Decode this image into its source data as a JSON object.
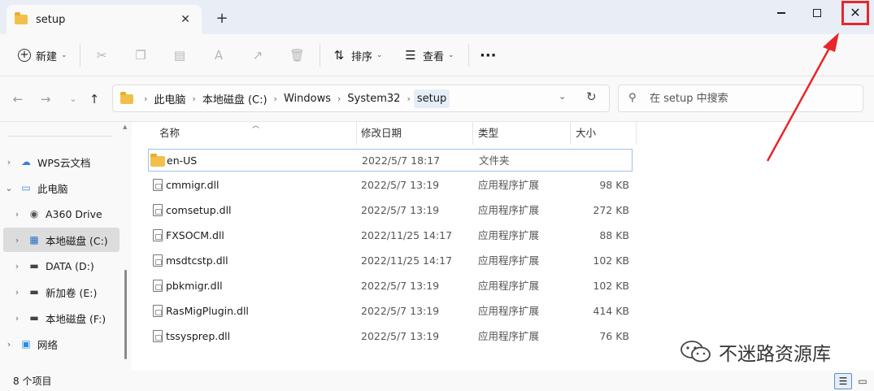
{
  "tab": {
    "title": "setup",
    "close_glyph": "✕",
    "new_tab_glyph": "+"
  },
  "window": {
    "minimize_glyph": "",
    "close_glyph": "✕"
  },
  "toolbar": {
    "new_label": "新建",
    "sort_label": "排序",
    "view_label": "查看",
    "more_glyph": "···"
  },
  "address": {
    "crumbs": [
      "此电脑",
      "本地磁盘 (C:)",
      "Windows",
      "System32",
      "setup"
    ]
  },
  "search": {
    "placeholder": "在 setup 中搜索"
  },
  "nav": {
    "items": [
      {
        "label": "WPS云文档",
        "icon": "cloud-icon",
        "expanded": false
      },
      {
        "label": "此电脑",
        "icon": "computer-icon",
        "expanded": true
      },
      {
        "label": "A360 Drive",
        "icon": "cloud-drive-icon",
        "expanded": false
      },
      {
        "label": "本地磁盘 (C:)",
        "icon": "windows-drive-icon",
        "expanded": false,
        "selected": true
      },
      {
        "label": "DATA (D:)",
        "icon": "drive-icon",
        "expanded": false
      },
      {
        "label": "新加卷 (E:)",
        "icon": "drive-icon",
        "expanded": false
      },
      {
        "label": "本地磁盘 (F:)",
        "icon": "drive-icon",
        "expanded": false
      },
      {
        "label": "网络",
        "icon": "network-icon",
        "expanded": false
      }
    ]
  },
  "columns": {
    "name": "名称",
    "date": "修改日期",
    "type": "类型",
    "size": "大小"
  },
  "files": [
    {
      "name": "en-US",
      "date": "2022/5/7 18:17",
      "type": "文件夹",
      "size": "",
      "kind": "folder"
    },
    {
      "name": "cmmigr.dll",
      "date": "2022/5/7 13:19",
      "type": "应用程序扩展",
      "size": "98 KB",
      "kind": "dll"
    },
    {
      "name": "comsetup.dll",
      "date": "2022/5/7 13:19",
      "type": "应用程序扩展",
      "size": "272 KB",
      "kind": "dll"
    },
    {
      "name": "FXSOCM.dll",
      "date": "2022/11/25 14:17",
      "type": "应用程序扩展",
      "size": "88 KB",
      "kind": "dll"
    },
    {
      "name": "msdtcstp.dll",
      "date": "2022/11/25 14:17",
      "type": "应用程序扩展",
      "size": "102 KB",
      "kind": "dll"
    },
    {
      "name": "pbkmigr.dll",
      "date": "2022/5/7 13:19",
      "type": "应用程序扩展",
      "size": "102 KB",
      "kind": "dll"
    },
    {
      "name": "RasMigPlugin.dll",
      "date": "2022/5/7 13:19",
      "type": "应用程序扩展",
      "size": "414 KB",
      "kind": "dll"
    },
    {
      "name": "tssysprep.dll",
      "date": "2022/5/7 13:19",
      "type": "应用程序扩展",
      "size": "76 KB",
      "kind": "dll"
    }
  ],
  "status": {
    "item_count": "8 个项目"
  },
  "watermark": {
    "text": "不迷路资源库"
  },
  "colors": {
    "highlight_box": "#e8262b",
    "arrow": "#e8262b",
    "accent": "#5a8fd0"
  }
}
